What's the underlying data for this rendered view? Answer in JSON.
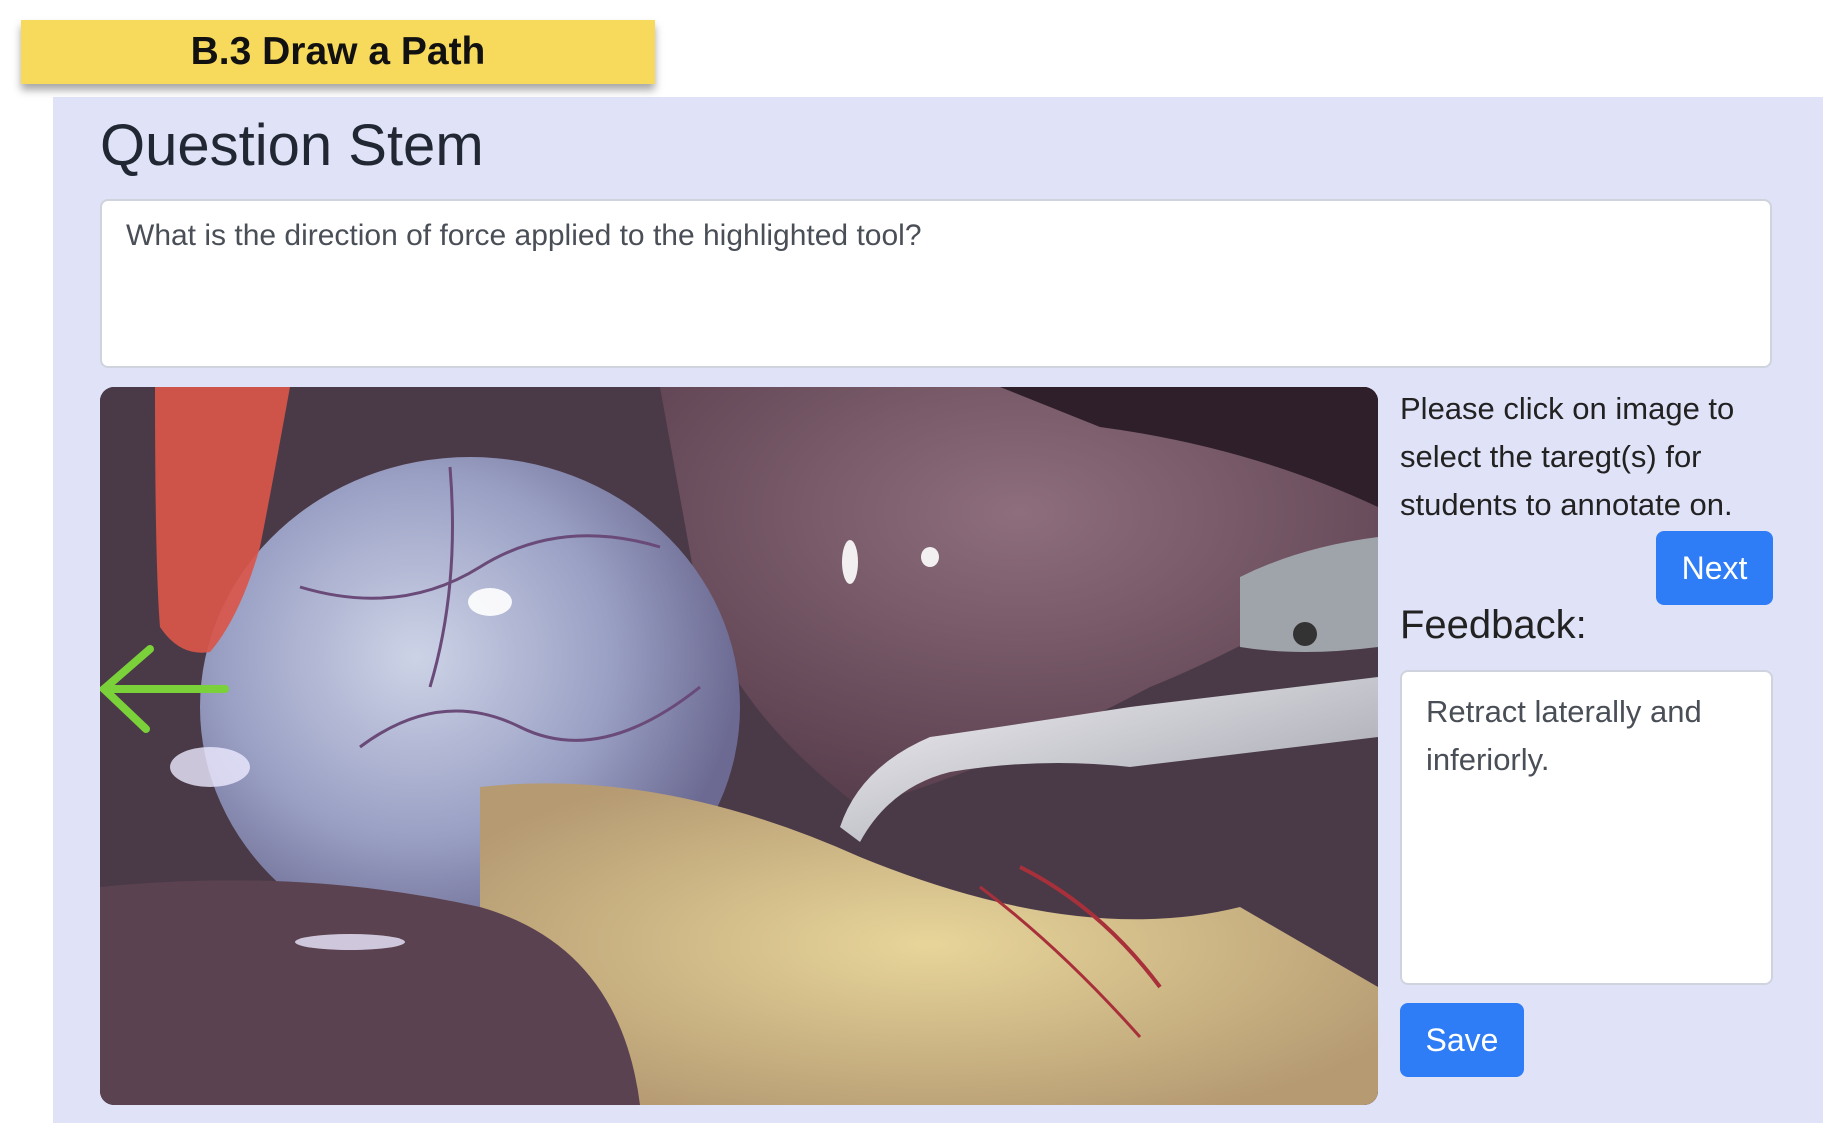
{
  "title_tag": "B.3 Draw a Path",
  "stem": {
    "heading": "Question Stem",
    "question": "What is the direction of force applied to the highlighted tool?"
  },
  "image": {
    "annotation_arrow_color": "#7bd13a",
    "highlight_color": "#d9564a"
  },
  "sidebar": {
    "instructions": "Please click on image to select the taregt(s) for students to annotate on.",
    "next_label": "Next",
    "feedback_label": "Feedback:",
    "feedback_text": "Retract laterally and inferiorly.",
    "save_label": "Save"
  },
  "colors": {
    "panel_bg": "#e0e3f8",
    "tag_bg": "#f7d95b",
    "button_bg": "#2f7df6"
  }
}
